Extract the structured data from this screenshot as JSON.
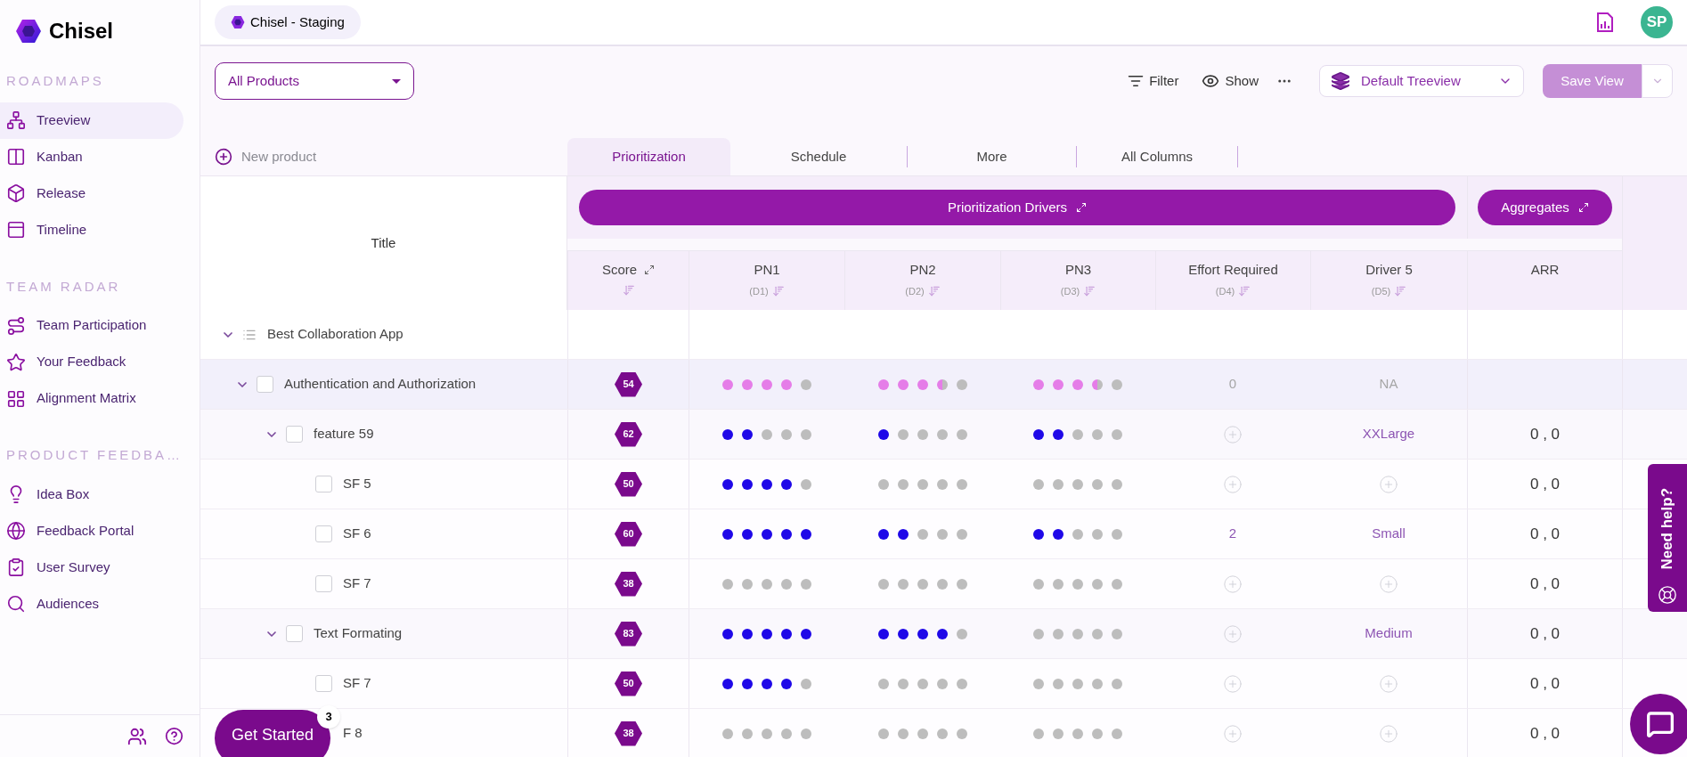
{
  "sidebar": {
    "logo": "Chisel",
    "sections": [
      {
        "title": "ROADMAPS",
        "items": [
          {
            "label": "Treeview",
            "selected": true
          },
          {
            "label": "Kanban",
            "selected": false
          },
          {
            "label": "Release",
            "selected": false
          },
          {
            "label": "Timeline",
            "selected": false
          }
        ]
      },
      {
        "title": "TEAM RADAR",
        "items": [
          {
            "label": "Team Participation",
            "selected": false
          },
          {
            "label": "Your Feedback",
            "selected": false
          },
          {
            "label": "Alignment Matrix",
            "selected": false
          }
        ]
      },
      {
        "title": "PRODUCT FEEDBA…",
        "items": [
          {
            "label": "Idea Box",
            "selected": false
          },
          {
            "label": "Feedback Portal",
            "selected": false
          },
          {
            "label": "User Survey",
            "selected": false
          },
          {
            "label": "Audiences",
            "selected": false
          }
        ]
      }
    ]
  },
  "topbar": {
    "workspace": "Chisel - Staging",
    "avatar": "SP"
  },
  "toolbar": {
    "product_select": "All Products",
    "filter": "Filter",
    "show": "Show",
    "view_select": "Default Treeview",
    "save_button": {
      "label": "Save View",
      "disabled": true
    }
  },
  "new_product": "New product",
  "tabs": [
    {
      "label": "Prioritization",
      "selected": true
    },
    {
      "label": "Schedule",
      "selected": false
    },
    {
      "label": "More",
      "selected": false
    },
    {
      "label": "All Columns",
      "selected": false
    }
  ],
  "table": {
    "title_column": "Title",
    "groups": [
      {
        "label": "Prioritization Drivers"
      },
      {
        "label": "Aggregates"
      }
    ],
    "columns": [
      {
        "label": "Score",
        "kind": "score"
      },
      {
        "label": "PN1",
        "code": "(D1)",
        "kind": "driver"
      },
      {
        "label": "PN2",
        "code": "(D2)",
        "kind": "driver"
      },
      {
        "label": "PN3",
        "code": "(D3)",
        "kind": "driver"
      },
      {
        "label": "Effort Required",
        "code": "(D4)",
        "kind": "driver"
      },
      {
        "label": "Driver 5",
        "code": "(D5)",
        "kind": "driver"
      },
      {
        "label": "ARR",
        "kind": "aggregate"
      }
    ],
    "rows": [
      {
        "title": "Best Collaboration App",
        "kind": "product",
        "expanded": true,
        "children": [
          {
            "title": "Authentication and Authorization",
            "kind": "epic",
            "expanded": true,
            "checked": false,
            "score": "54",
            "drivers": [
              {
                "stars": 4
              },
              {
                "stars": 3.5
              },
              {
                "stars": 3.5
              }
            ],
            "effort": "0",
            "driver5": "NA",
            "children": [
              {
                "title": "feature 59",
                "kind": "feature",
                "expanded": true,
                "checked": false,
                "score": "62",
                "drivers": [
                  {
                    "stars": 2
                  },
                  {
                    "stars": 1
                  },
                  {
                    "stars": 2
                  }
                ],
                "driver5": "XXLarge",
                "arr": "0 , 0",
                "children": [
                  {
                    "title": "SF 5",
                    "kind": "subfeature",
                    "checked": false,
                    "score": "50",
                    "drivers": [
                      {
                        "stars": 4
                      },
                      {
                        "stars": 0
                      },
                      {
                        "stars": 0
                      }
                    ],
                    "arr": "0 , 0"
                  },
                  {
                    "title": "SF 6",
                    "kind": "subfeature",
                    "checked": false,
                    "score": "60",
                    "drivers": [
                      {
                        "stars": 5
                      },
                      {
                        "stars": 2
                      },
                      {
                        "stars": 2
                      }
                    ],
                    "effort": "2",
                    "driver5": "Small",
                    "arr": "0 , 0"
                  },
                  {
                    "title": "SF 7",
                    "kind": "subfeature",
                    "checked": false,
                    "score": "38",
                    "drivers": [
                      {
                        "stars": 0
                      },
                      {
                        "stars": 0
                      },
                      {
                        "stars": 0
                      }
                    ],
                    "arr": "0 , 0"
                  }
                ]
              },
              {
                "title": "Text Formating",
                "kind": "feature",
                "expanded": true,
                "checked": false,
                "score": "83",
                "drivers": [
                  {
                    "stars": 5
                  },
                  {
                    "stars": 4
                  },
                  {
                    "stars": 0
                  }
                ],
                "driver5": "Medium",
                "arr": "0 , 0",
                "children": [
                  {
                    "title": "SF 7",
                    "kind": "subfeature",
                    "checked": false,
                    "score": "50",
                    "drivers": [
                      {
                        "stars": 4
                      },
                      {
                        "stars": 0
                      },
                      {
                        "stars": 0
                      }
                    ],
                    "arr": "0 , 0"
                  },
                  {
                    "title": "F 8",
                    "kind": "subfeature",
                    "score": "38",
                    "drivers": [
                      {
                        "stars": 0
                      },
                      {
                        "stars": 0
                      },
                      {
                        "stars": 0
                      }
                    ],
                    "arr": "0 , 0"
                  }
                ]
              }
            ]
          }
        ]
      }
    ]
  },
  "get_started": {
    "label": "Get Started",
    "count": "3"
  },
  "help_tab": "Need help?"
}
